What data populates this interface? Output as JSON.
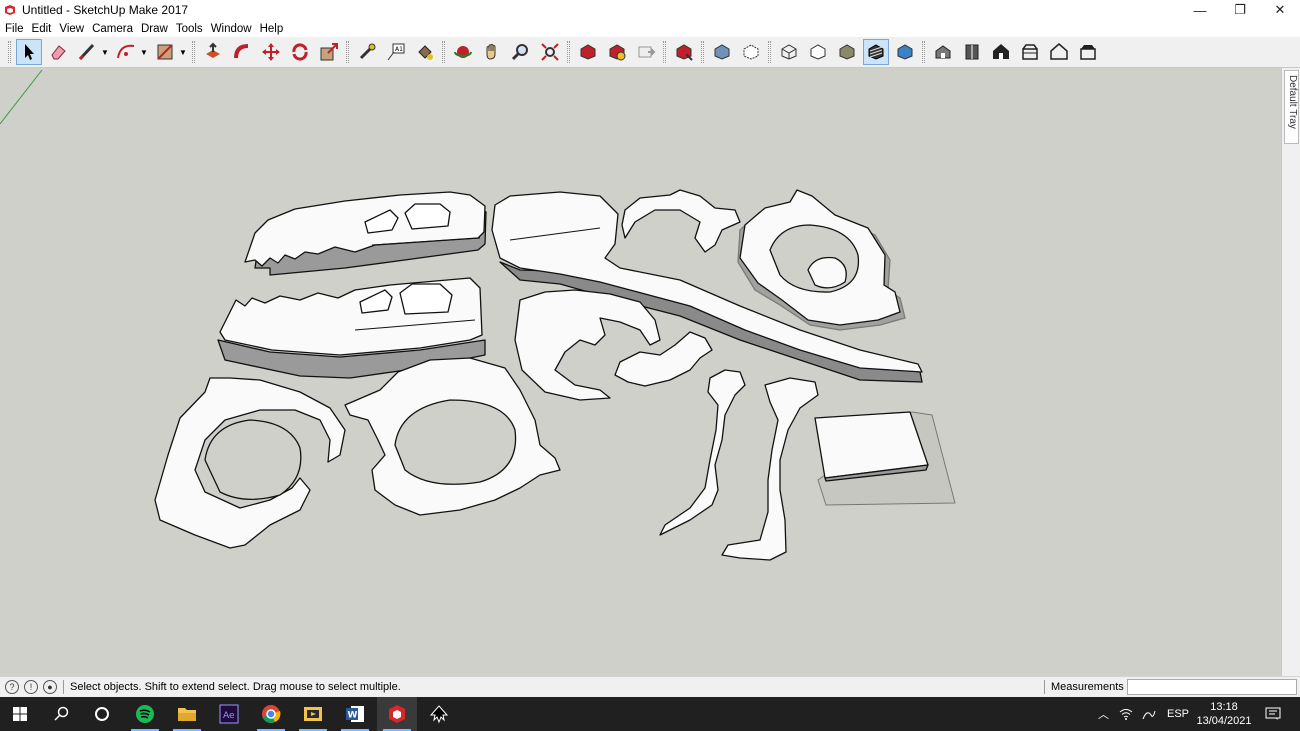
{
  "window": {
    "title": "Untitled - SketchUp Make 2017",
    "minimize": "—",
    "maximize": "❐",
    "close": "✕"
  },
  "menu": [
    "File",
    "Edit",
    "View",
    "Camera",
    "Draw",
    "Tools",
    "Window",
    "Help"
  ],
  "toolbar": {
    "tools": [
      "select-icon",
      "eraser-icon",
      "line-icon",
      "arc-icon",
      "rectangle-icon",
      "push-pull-icon",
      "follow-me-icon",
      "move-icon",
      "rotate-icon",
      "scale-icon",
      "tape-measure-icon",
      "text-icon",
      "paint-bucket-icon",
      "orbit-icon",
      "pan-icon",
      "zoom-icon",
      "zoom-extents-icon",
      "warehouse-icon",
      "extension-warehouse-icon",
      "send-to-layout-icon",
      "extension-manager-icon",
      "xray-icon",
      "back-edges-icon",
      "wireframe-icon",
      "hidden-line-icon",
      "shaded-icon",
      "shaded-textures-icon",
      "monochrome-icon",
      "iso-view-icon",
      "top-view-icon",
      "front-view-icon",
      "right-view-icon",
      "back-view-icon",
      "left-view-icon"
    ]
  },
  "tray": {
    "label": "Default Tray"
  },
  "status": {
    "text": "Select objects. Shift to extend select. Drag mouse to select multiple.",
    "measurements_label": "Measurements",
    "measurements_value": ""
  },
  "taskbar": {
    "apps": [
      "windows-start-icon",
      "search-icon",
      "cortana-icon",
      "spotify-icon",
      "file-explorer-icon",
      "after-effects-icon",
      "chrome-icon",
      "media-player-icon",
      "word-icon",
      "sketchup-icon",
      "inkscape-icon"
    ],
    "language": "ESP",
    "time": "13:18",
    "date": "13/04/2021"
  },
  "colors": {
    "viewport_bg": "#d0d0cb",
    "taskbar_bg": "#202020",
    "accent": "#7ab7ff",
    "sketchup_red": "#d9262a"
  }
}
